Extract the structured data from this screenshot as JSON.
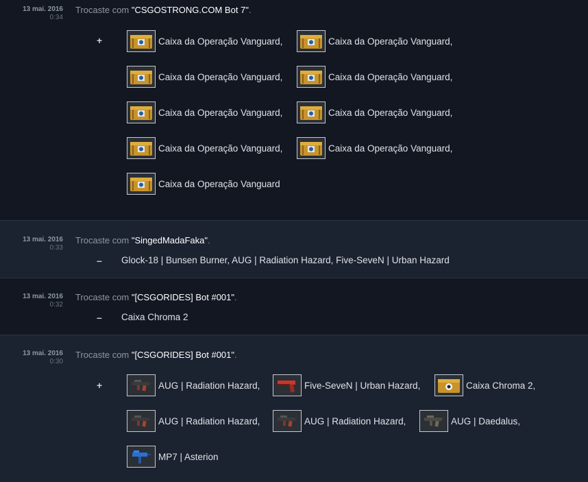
{
  "trades": [
    {
      "date": "13 mai. 2016",
      "time": "0:34",
      "prefix": "Trocaste com ",
      "partner": "\"CSGOSTRONG.COM Bot 7\"",
      "suffix": ".",
      "sign": "+",
      "items": [
        {
          "name": "Caixa da Operação Vanguard,",
          "icon": "vanguard-case-icon"
        },
        {
          "name": "Caixa da Operação Vanguard,",
          "icon": "vanguard-case-icon"
        },
        {
          "name": "Caixa da Operação Vanguard,",
          "icon": "vanguard-case-icon"
        },
        {
          "name": "Caixa da Operação Vanguard,",
          "icon": "vanguard-case-icon"
        },
        {
          "name": "Caixa da Operação Vanguard,",
          "icon": "vanguard-case-icon"
        },
        {
          "name": "Caixa da Operação Vanguard,",
          "icon": "vanguard-case-icon"
        },
        {
          "name": "Caixa da Operação Vanguard,",
          "icon": "vanguard-case-icon"
        },
        {
          "name": "Caixa da Operação Vanguard,",
          "icon": "vanguard-case-icon"
        },
        {
          "name": "Caixa da Operação Vanguard",
          "icon": "vanguard-case-icon"
        }
      ]
    },
    {
      "date": "13 mai. 2016",
      "time": "0:33",
      "prefix": "Trocaste com ",
      "partner": "\"SingedMadaFaka\"",
      "suffix": ".",
      "sign": "–",
      "items_text": "Glock-18 | Bunsen Burner, AUG | Radiation Hazard, Five-SeveN | Urban Hazard"
    },
    {
      "date": "13 mai. 2016",
      "time": "0:32",
      "prefix": "Trocaste com ",
      "partner": "\"[CSGORIDES] Bot #001\"",
      "suffix": ".",
      "sign": "–",
      "items_text": "Caixa Chroma 2"
    },
    {
      "date": "13 mai. 2016",
      "time": "0:30",
      "prefix": "Trocaste com ",
      "partner": "\"[CSGORIDES] Bot #001\"",
      "suffix": ".",
      "sign": "+",
      "items": [
        {
          "name": "AUG | Radiation Hazard,",
          "icon": "aug-rifle-icon"
        },
        {
          "name": "Five-SeveN | Urban Hazard,",
          "icon": "pistol-icon"
        },
        {
          "name": "Caixa Chroma 2,",
          "icon": "chroma-case-icon"
        },
        {
          "name": "AUG | Radiation Hazard,",
          "icon": "aug-rifle-icon"
        },
        {
          "name": "AUG | Radiation Hazard,",
          "icon": "aug-rifle-icon"
        },
        {
          "name": "AUG | Daedalus,",
          "icon": "aug-rifle-icon"
        },
        {
          "name": "MP7 | Asterion",
          "icon": "smg-icon"
        }
      ]
    }
  ]
}
